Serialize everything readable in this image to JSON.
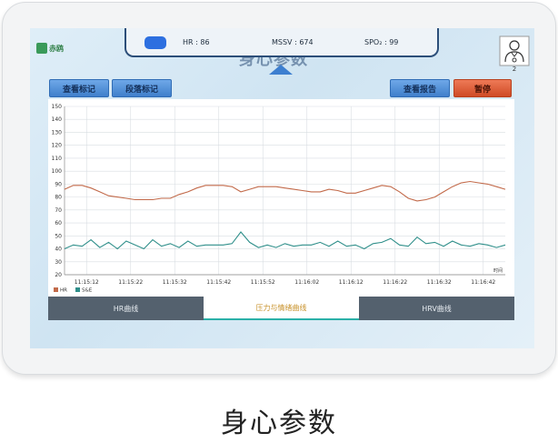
{
  "app": {
    "logo_text": "赤鸥"
  },
  "vitals": {
    "hr_label": "HR",
    "hr_value": "86",
    "msv_label": "MSSV",
    "msv_value": "674",
    "spo2_label": "SPO₂",
    "spo2_value": "99"
  },
  "screen_title": "身心参数",
  "user": {
    "count": "2"
  },
  "toolbar": {
    "view_marks": "查看标记",
    "segment_mark": "段落标记",
    "view_report": "查看报告",
    "pause": "暂停"
  },
  "tabs": [
    {
      "label": "HR曲线",
      "active": false
    },
    {
      "label": "压力与情绪曲线",
      "active": true
    },
    {
      "label": "HRV曲线",
      "active": false
    }
  ],
  "caption": "身心参数",
  "colors": {
    "hr": "#c26a4a",
    "se": "#2f8f8a",
    "accent": "#3d7fd0",
    "pause": "#d9532c"
  },
  "chart_data": {
    "type": "line",
    "x_axis_unit": "时间",
    "x_ticks": [
      "11:15:12",
      "11:15:22",
      "11:15:32",
      "11:15:42",
      "11:15:52",
      "11:16:02",
      "11:16:12",
      "11:16:22",
      "11:16:32",
      "11:16:42"
    ],
    "y_ticks": [
      20,
      30,
      40,
      50,
      60,
      70,
      80,
      90,
      100,
      110,
      120,
      130,
      140,
      150
    ],
    "ylim": [
      20,
      150
    ],
    "xlim": [
      0,
      100
    ],
    "grid": true,
    "legend": {
      "position": "bottom-left",
      "items": [
        "HR",
        "S&E"
      ]
    },
    "series": [
      {
        "name": "HR",
        "color": "#c26a4a",
        "x": [
          0,
          2,
          4,
          6,
          8,
          10,
          12,
          14,
          16,
          18,
          20,
          22,
          24,
          26,
          28,
          30,
          32,
          34,
          36,
          38,
          40,
          42,
          44,
          46,
          48,
          50,
          52,
          54,
          56,
          58,
          60,
          62,
          64,
          66,
          68,
          70,
          72,
          74,
          76,
          78,
          80,
          82,
          84,
          86,
          88,
          90,
          92,
          94,
          96,
          98,
          100
        ],
        "values": [
          86,
          89,
          89,
          87,
          84,
          81,
          80,
          79,
          78,
          78,
          78,
          79,
          79,
          82,
          84,
          87,
          89,
          89,
          89,
          88,
          84,
          86,
          88,
          88,
          88,
          87,
          86,
          85,
          84,
          84,
          86,
          85,
          83,
          83,
          85,
          87,
          89,
          88,
          84,
          79,
          77,
          78,
          80,
          84,
          88,
          91,
          92,
          91,
          90,
          88,
          86
        ]
      },
      {
        "name": "S&E",
        "color": "#2f8f8a",
        "x": [
          0,
          2,
          4,
          6,
          8,
          10,
          12,
          14,
          16,
          18,
          20,
          22,
          24,
          26,
          28,
          30,
          32,
          34,
          36,
          38,
          40,
          42,
          44,
          46,
          48,
          50,
          52,
          54,
          56,
          58,
          60,
          62,
          64,
          66,
          68,
          70,
          72,
          74,
          76,
          78,
          80,
          82,
          84,
          86,
          88,
          90,
          92,
          94,
          96,
          98,
          100
        ],
        "values": [
          40,
          43,
          42,
          47,
          41,
          45,
          40,
          46,
          43,
          40,
          47,
          42,
          44,
          41,
          46,
          42,
          43,
          43,
          43,
          44,
          53,
          45,
          41,
          43,
          41,
          44,
          42,
          43,
          43,
          45,
          42,
          46,
          42,
          43,
          40,
          44,
          45,
          48,
          43,
          42,
          49,
          44,
          45,
          42,
          46,
          43,
          42,
          44,
          43,
          41,
          43
        ]
      }
    ]
  }
}
